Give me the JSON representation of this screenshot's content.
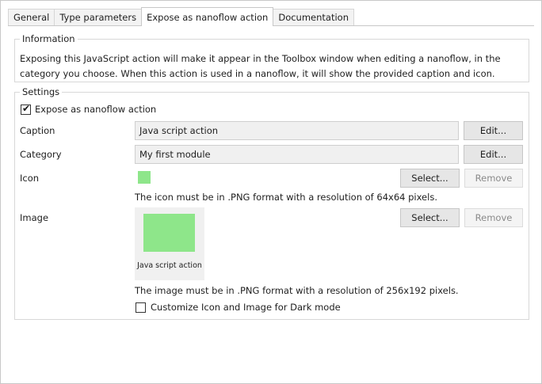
{
  "tabs": [
    {
      "label": "General"
    },
    {
      "label": "Type parameters"
    },
    {
      "label": "Expose as nanoflow action"
    },
    {
      "label": "Documentation"
    }
  ],
  "information": {
    "legend": "Information",
    "text": "Exposing this JavaScript action will make it appear in the Toolbox window when editing a nanoflow, in the category you choose. When this action is used in a nanoflow, it will show the provided caption and icon."
  },
  "settings": {
    "legend": "Settings",
    "expose_label": "Expose as nanoflow action",
    "expose_checked": true,
    "caption": {
      "label": "Caption",
      "value": "Java script action",
      "button": "Edit..."
    },
    "category": {
      "label": "Category",
      "value": "My first module",
      "button": "Edit..."
    },
    "icon": {
      "label": "Icon",
      "color": "#8ee68a",
      "select_button": "Select...",
      "remove_button": "Remove",
      "note": "The icon must be in .PNG format with a resolution of 64x64 pixels."
    },
    "image": {
      "label": "Image",
      "color": "#8ee68a",
      "preview_caption": "Java script action",
      "select_button": "Select...",
      "remove_button": "Remove",
      "note": "The image must be in .PNG format with a resolution of 256x192 pixels."
    },
    "dark_mode_label": "Customize Icon and Image for Dark mode",
    "dark_mode_checked": false
  }
}
